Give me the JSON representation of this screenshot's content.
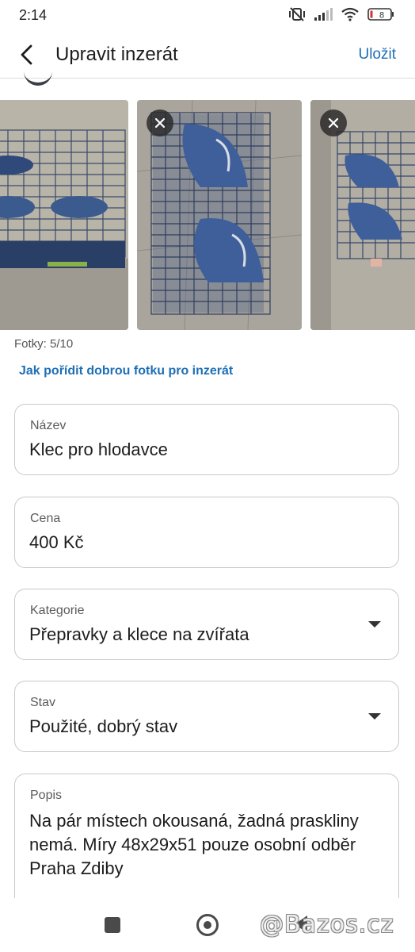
{
  "status_bar": {
    "time": "2:14",
    "battery": "8",
    "icons": [
      "mute-vibrate-icon",
      "signal-icon",
      "wifi-icon",
      "battery-icon"
    ]
  },
  "app_bar": {
    "title": "Upravit inzerát",
    "save_label": "Uložit",
    "back_icon": "back-arrow-icon"
  },
  "photos": {
    "count_text": "Fotky: 5/10",
    "tip_link": "Jak pořídit dobrou fotku pro inzerát",
    "remove_icon": "close-icon"
  },
  "form": {
    "name": {
      "label": "Název",
      "value": "Klec pro hlodavce"
    },
    "price": {
      "label": "Cena",
      "value": "400 Kč"
    },
    "category": {
      "label": "Kategorie",
      "value": "Přepravky a klece na zvířata"
    },
    "condition": {
      "label": "Stav",
      "value": "Použité, dobrý stav"
    },
    "description": {
      "label": "Popis",
      "value": "Na pár místech okousaná, žadná praskliny nemá. Míry 48x29x51 pouze osobní odběr Praha Zdiby"
    }
  },
  "watermark": "@Bazos.cz",
  "colors": {
    "accent": "#1f6fb5",
    "border": "#c9c9c9",
    "cage_blue": "#2f4a7a"
  }
}
